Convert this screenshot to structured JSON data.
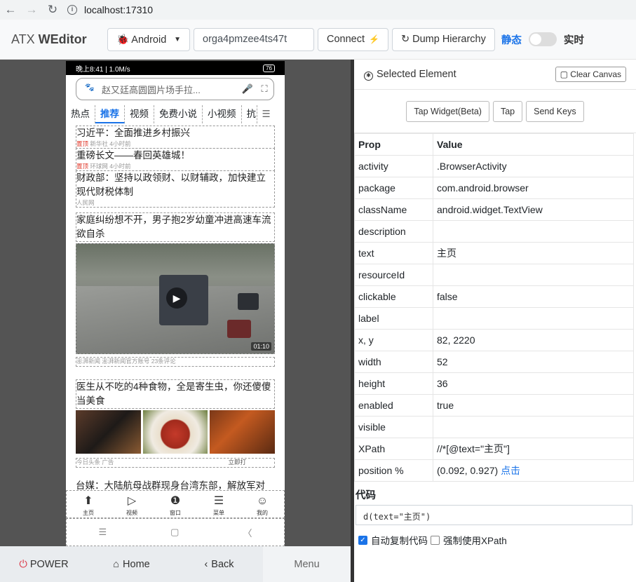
{
  "browser": {
    "url": "localhost:17310"
  },
  "header": {
    "brand_prefix": "ATX ",
    "brand_bold": "WEditor",
    "platform": "Android",
    "serial": "orga4pmzee4ts47t",
    "connect_label": "Connect",
    "dump_label": "Dump Hierarchy",
    "mode_static": "静态",
    "mode_live": "实时"
  },
  "phone": {
    "status_left": "晚上8:41 | 1.0M/s",
    "status_right": "76",
    "search_text": "赵又廷高圆圆片场手拉...",
    "tabs": [
      "热点",
      "推荐",
      "视频",
      "免费小说",
      "小视频",
      "抗"
    ],
    "active_tab": "推荐",
    "news": [
      {
        "title": "习近平：全面推进乡村振兴",
        "tag": "置顶",
        "meta": "新华社 4小时前"
      },
      {
        "title": "重磅长文——春回英雄城！",
        "tag": "置顶",
        "meta": "环球网 4小时前"
      },
      {
        "title": "财政部：坚持以政领财、以财辅政，加快建立现代财税体制",
        "tag": "",
        "meta": "人民网"
      },
      {
        "title": "家庭纠纷想不开，男子抱2岁幼童冲进高速车流欲自杀",
        "tag": "",
        "meta": "澎湃新闻 澎湃新闻官方账号 23条评论"
      },
      {
        "title": "医生从不吃的4种食物，全是寄生虫，你还傻傻当美食",
        "tag": "",
        "meta": "今日头条 广告",
        "ad": "立即打"
      },
      {
        "title": "台媒：大陆航母战群现身台湾东部，解放军对",
        "tag": "",
        "meta": ""
      }
    ],
    "video_duration": "01:10",
    "bottom_nav": [
      {
        "icon": "home-icon",
        "glyph": "⬆",
        "label": "主页"
      },
      {
        "icon": "video-icon",
        "glyph": "▷",
        "label": "视频"
      },
      {
        "icon": "window-icon",
        "glyph": "❶",
        "label": "窗口"
      },
      {
        "icon": "menu-icon",
        "glyph": "☰",
        "label": "菜单"
      },
      {
        "icon": "profile-icon",
        "glyph": "☺",
        "label": "我的"
      }
    ],
    "sys_nav": [
      "☰",
      "▢",
      "〈"
    ]
  },
  "device_controls": {
    "power": "POWER",
    "home": "Home",
    "back": "Back",
    "menu": "Menu"
  },
  "inspector": {
    "title": "Selected Element",
    "clear_label": "Clear Canvas",
    "actions": [
      "Tap Widget(Beta)",
      "Tap",
      "Send Keys"
    ],
    "col_prop": "Prop",
    "col_value": "Value",
    "rows": [
      {
        "prop": "activity",
        "value": ".BrowserActivity"
      },
      {
        "prop": "package",
        "value": "com.android.browser"
      },
      {
        "prop": "className",
        "value": "android.widget.TextView"
      },
      {
        "prop": "description",
        "value": ""
      },
      {
        "prop": "text",
        "value": "主页"
      },
      {
        "prop": "resourceId",
        "value": ""
      },
      {
        "prop": "clickable",
        "value": "false"
      },
      {
        "prop": "label",
        "value": ""
      },
      {
        "prop": "x, y",
        "value": "82, 2220"
      },
      {
        "prop": "width",
        "value": "52"
      },
      {
        "prop": "height",
        "value": "36"
      },
      {
        "prop": "enabled",
        "value": "true"
      },
      {
        "prop": "visible",
        "value": ""
      },
      {
        "prop": "XPath",
        "value": "//*[@text=\"主页\"]"
      }
    ],
    "position_label": "position %",
    "position_value": "(0.092, 0.927)",
    "position_link": "点击",
    "code_title": "代码",
    "code": "d(text=\"主页\")",
    "opt_autocopy": "自动复制代码",
    "opt_xpath": "强制使用XPath"
  }
}
